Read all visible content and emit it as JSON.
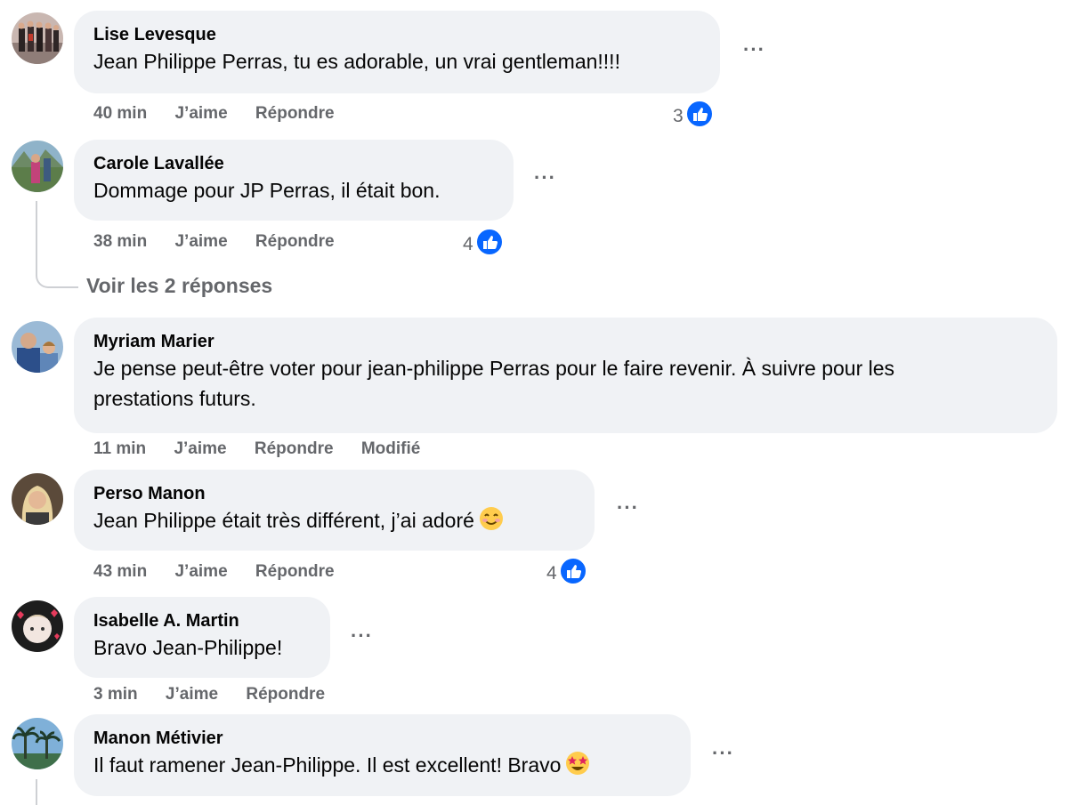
{
  "comments": [
    {
      "author": "Lise Levesque",
      "text": "Jean Philippe Perras, tu es adorable, un vrai gentleman!!!!",
      "time": "40 min",
      "like_label": "J’aime",
      "reply_label": "Répondre",
      "reactions": "3",
      "more": "···"
    },
    {
      "author": "Carole Lavallée",
      "text": "Dommage pour JP Perras, il était bon.",
      "time": "38 min",
      "like_label": "J’aime",
      "reply_label": "Répondre",
      "reactions": "4",
      "more": "···",
      "view_replies": "Voir les 2 réponses"
    },
    {
      "author": "Myriam Marier",
      "text_line1": "Je pense peut-être voter pour jean-philippe Perras pour le faire revenir. À suivre pour les",
      "text_line2": "prestations futurs.",
      "time": "11 min",
      "like_label": "J’aime",
      "reply_label": "Répondre",
      "edited_label": "Modifié"
    },
    {
      "author": "Perso Manon",
      "text": "Jean Philippe était très différent, j’ai adoré",
      "emoji": "smiling-face-emoji",
      "time": "43 min",
      "like_label": "J’aime",
      "reply_label": "Répondre",
      "reactions": "4",
      "more": "···"
    },
    {
      "author": "Isabelle A. Martin",
      "text": "Bravo Jean-Philippe!",
      "time": "3 min",
      "like_label": "J’aime",
      "reply_label": "Répondre",
      "more": "···"
    },
    {
      "author": "Manon Métivier",
      "text": "Il faut ramener Jean-Philippe. Il est excellent! Bravo",
      "emoji": "star-struck-emoji",
      "more": "···"
    }
  ],
  "colors": {
    "bubble": "#f0f2f5",
    "secondary_text": "#65676b",
    "like_blue": "#0866ff"
  }
}
